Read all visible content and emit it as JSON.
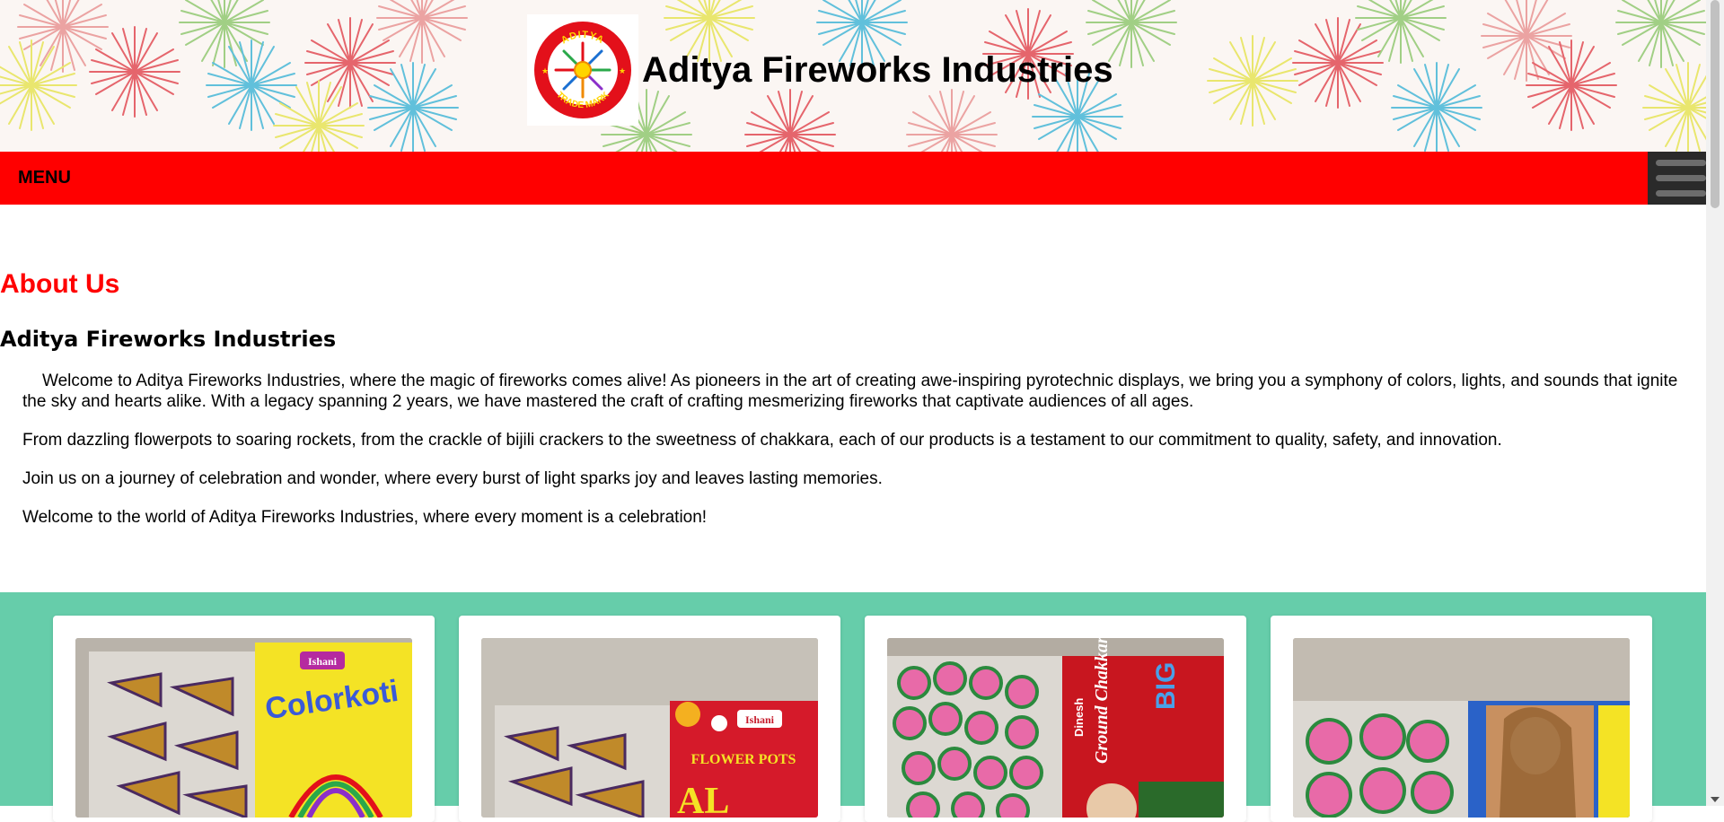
{
  "header": {
    "site_title": "Aditya Fireworks Industries",
    "logo": {
      "top_text": "ADITYA",
      "bottom_text": "TRADE MARK",
      "icon": "sun-logo-icon"
    }
  },
  "nav": {
    "menu_label": "MENU",
    "hamburger_icon": "hamburger-menu-icon"
  },
  "about": {
    "heading": "About Us",
    "company_name": "Aditya Fireworks Industries",
    "paragraphs": [
      "Welcome to Aditya Fireworks Industries, where the magic of fireworks comes alive! As pioneers in the art of creating awe-inspiring pyrotechnic displays, we bring you a symphony of colors, lights, and sounds that ignite the sky and hearts alike. With a legacy spanning 2 years, we have mastered the craft of crafting mesmerizing fireworks that captivate audiences of all ages.",
      "From dazzling flowerpots to soaring rockets, from the crackle of bijili crackers to the sweetness of chakkara, each of our products is a testament to our commitment to quality, safety, and innovation.",
      "Join us on a journey of celebration and wonder, where every burst of light sparks joy and leaves lasting memories.",
      "Welcome to the world of Aditya Fireworks Industries, where every moment is a celebration!"
    ]
  },
  "products": [
    {
      "brand": "Ishani",
      "box_text": "Colorkoti"
    },
    {
      "brand": "Ishani",
      "box_text": "FLOWER POTS",
      "box_text_partial": "AL"
    },
    {
      "brand": "Dinesh",
      "box_text": "Ground Chakkar",
      "box_text_2": "BIG"
    },
    {
      "brand": "",
      "box_text": ""
    }
  ],
  "colors": {
    "menu_bar": "#ff0000",
    "about_heading": "#ff0000",
    "products_band": "#66cdaa",
    "header_bg": "#fbf6f3"
  }
}
